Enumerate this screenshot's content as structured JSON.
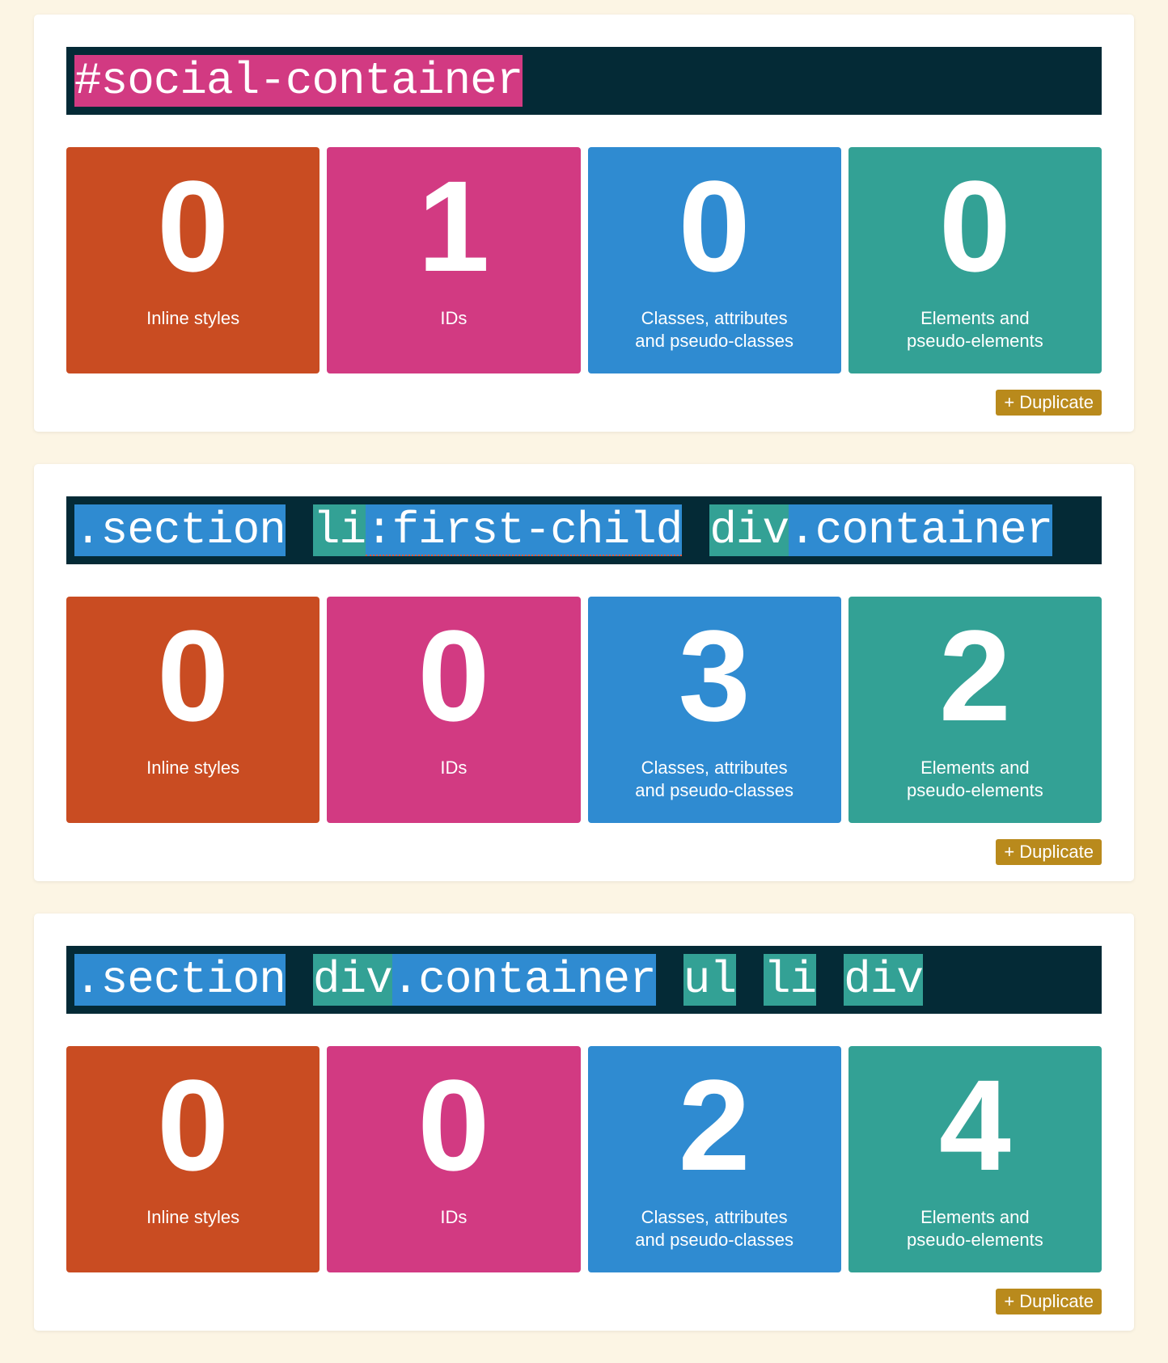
{
  "colors": {
    "background": "#fcf5e4",
    "selector_bar": "#042a36",
    "inline": "#c94c22",
    "ids": "#d23a82",
    "classes": "#2f8bd1",
    "elements": "#33a195",
    "duplicate_button": "#b98a1c"
  },
  "labels": {
    "inline": "Inline styles",
    "ids": "IDs",
    "classes": "Classes, attributes\nand pseudo-classes",
    "elements": "Elements and\npseudo-elements",
    "duplicate": "+ Duplicate"
  },
  "cards": [
    {
      "selector_parts": [
        [
          {
            "text": "#social-container",
            "type": "id"
          }
        ]
      ],
      "specificity": [
        "0",
        "1",
        "0",
        "0"
      ]
    },
    {
      "selector_parts": [
        [
          {
            "text": ".section",
            "type": "class"
          }
        ],
        [
          {
            "text": "li",
            "type": "el"
          },
          {
            "text": ":first-child",
            "type": "pseudo"
          }
        ],
        [
          {
            "text": "div",
            "type": "el"
          },
          {
            "text": ".container",
            "type": "class"
          }
        ]
      ],
      "specificity": [
        "0",
        "0",
        "3",
        "2"
      ]
    },
    {
      "selector_parts": [
        [
          {
            "text": ".section",
            "type": "class"
          }
        ],
        [
          {
            "text": "div",
            "type": "el"
          },
          {
            "text": ".container",
            "type": "class"
          }
        ],
        [
          {
            "text": "ul",
            "type": "el"
          }
        ],
        [
          {
            "text": "li",
            "type": "el"
          }
        ],
        [
          {
            "text": "div",
            "type": "el"
          }
        ]
      ],
      "specificity": [
        "0",
        "0",
        "2",
        "4"
      ]
    }
  ]
}
